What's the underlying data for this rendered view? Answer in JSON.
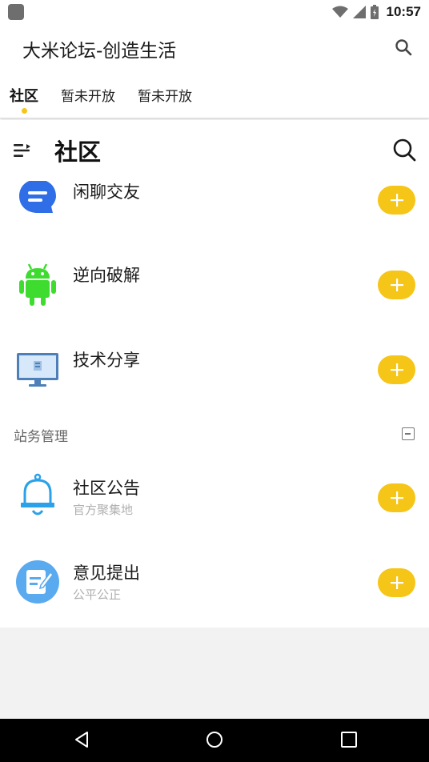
{
  "status_bar": {
    "time": "10:57",
    "icons": [
      "notification-icon",
      "wifi-icon",
      "signal-icon",
      "battery-icon"
    ]
  },
  "app_bar": {
    "title": "大米论坛-创造生活",
    "search_icon": "search-icon"
  },
  "tabs": [
    {
      "label": "社区",
      "active": true
    },
    {
      "label": "暂未开放",
      "active": false
    },
    {
      "label": "暂未开放",
      "active": false
    }
  ],
  "page_header": {
    "title": "社区",
    "menu_icon": "menu-icon",
    "search_icon": "search-icon"
  },
  "forums": [
    {
      "name": "闲聊交友",
      "desc": "",
      "icon": "chat-bubble-icon"
    },
    {
      "name": "逆向破解",
      "desc": "",
      "icon": "android-icon"
    },
    {
      "name": "技术分享",
      "desc": "",
      "icon": "monitor-icon"
    }
  ],
  "section": {
    "title": "站务管理",
    "collapse_icon": "collapse-icon"
  },
  "admin_forums": [
    {
      "name": "社区公告",
      "desc": "官方聚集地",
      "icon": "bell-icon"
    },
    {
      "name": "意见提出",
      "desc": "公平公正",
      "icon": "edit-note-icon"
    }
  ],
  "add_button_icon": "plus-icon",
  "colors": {
    "accent": "#f5c518",
    "chat_blue": "#2f6ee6",
    "android_green": "#3ddc2f",
    "bell_blue": "#2aa1e8",
    "note_blue": "#5aaaf0"
  },
  "nav_bar": {
    "icons": [
      "back-icon",
      "home-icon",
      "recent-apps-icon"
    ]
  }
}
